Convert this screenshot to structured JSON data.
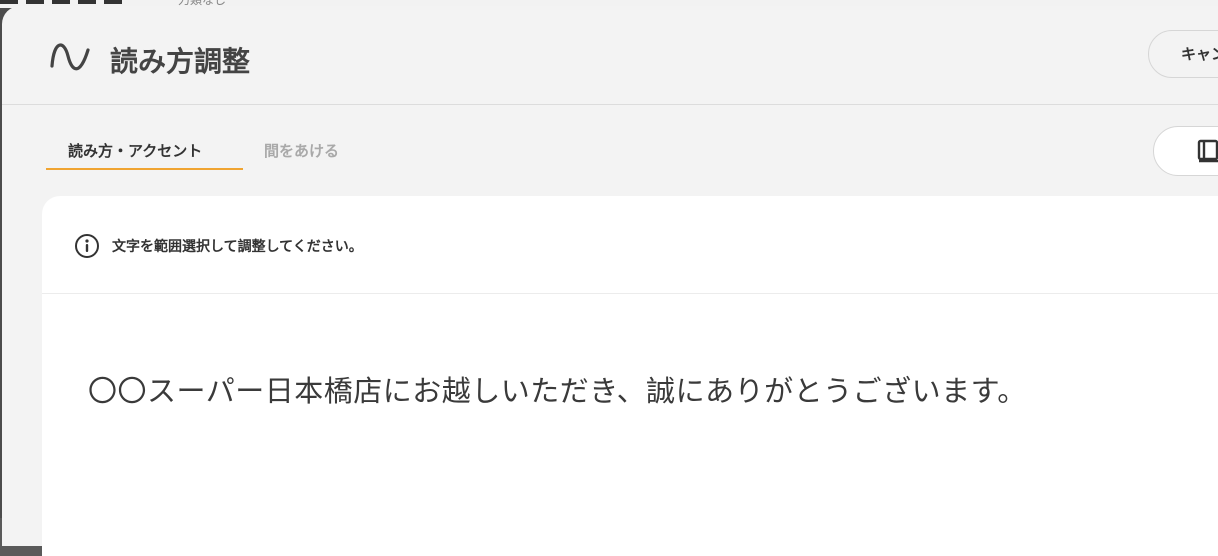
{
  "background": {
    "partial_text": "力類なし"
  },
  "dialog": {
    "title": "読み方調整",
    "cancel_label": "キャンセル"
  },
  "tabs": [
    {
      "label": "読み方・アクセント",
      "active": true
    },
    {
      "label": "間をあける",
      "active": false
    }
  ],
  "hint": {
    "text": "文字を範囲選択して調整してください。"
  },
  "editor": {
    "sentence": "〇〇スーパー日本橋店にお越しいただき、誠にありがとうございます。"
  },
  "icons": {
    "logo": "wave-icon",
    "dictionary": "book-icon",
    "info": "info-icon"
  },
  "colors": {
    "accent": "#f0a431",
    "text": "#444444",
    "inactive_tab": "#a9a9a9"
  }
}
